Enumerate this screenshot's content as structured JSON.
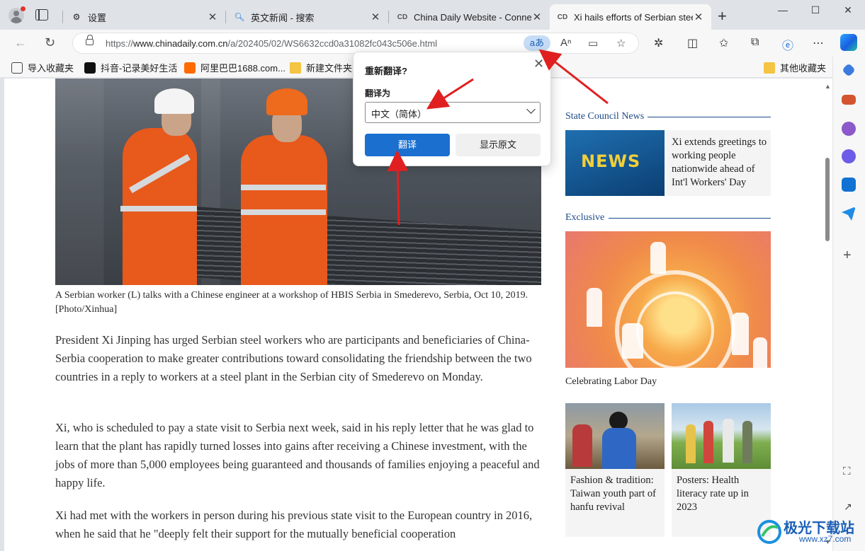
{
  "tabs": [
    {
      "title": "设置",
      "icon": "gear-icon"
    },
    {
      "title": "英文新闻 - 搜索",
      "icon": "search-icon"
    },
    {
      "title": "China Daily Website - Connecti",
      "icon": "cd-logo-icon"
    },
    {
      "title": "Xi hails efforts of Serbian steel",
      "icon": "cd-logo-icon",
      "active": true
    }
  ],
  "address_bar": {
    "url_prefix": "https://",
    "url_host": "www.chinadaily.com.cn",
    "url_path": "/a/202405/02/WS6632ccd0a31082fc043c506e.html",
    "translate_badge": "aあ"
  },
  "favorites": [
    {
      "label": "导入收藏夹",
      "icon": "import-icon"
    },
    {
      "label": "抖音-记录美好生活",
      "icon": "douyin-icon"
    },
    {
      "label": "阿里巴巴1688.com...",
      "icon": "alibaba-icon"
    },
    {
      "label": "新建文件夹",
      "icon": "folder-icon"
    },
    {
      "label": "其他收藏夹",
      "icon": "folder-icon"
    }
  ],
  "translate_popup": {
    "title": "重新翻译?",
    "label": "翻译为",
    "selected_language": "中文（简体）",
    "translate_button": "翻译",
    "show_original_button": "显示原文"
  },
  "article": {
    "caption": "A Serbian worker (L) talks with a Chinese engineer at a workshop of HBIS Serbia in Smederevo, Serbia, Oct 10, 2019. [Photo/Xinhua]",
    "paragraphs": [
      "President Xi Jinping has urged Serbian steel workers who are participants and beneficiaries of China-Serbia cooperation to make greater contributions toward consolidating the friendship between the two countries in a reply to workers at a steel plant in the Serbian city of Smederevo on Monday.",
      "Xi, who is scheduled to pay a state visit to Serbia next week, said in his reply letter that he was glad to learn that the plant has rapidly turned losses into gains after receiving a Chinese investment, with the jobs of more than 5,000 employees being guaranteed and thousands of families enjoying a peaceful and happy life.",
      "Xi had met with the workers in person during his previous state visit to the European country in 2016, when he said that he \"deeply felt their support for the mutually beneficial cooperation"
    ]
  },
  "sidebar_right": {
    "state_council": {
      "section": "State Council News",
      "image_word": "NEWS",
      "headline": "Xi extends greetings to working people nationwide ahead of Int'l Workers' Day"
    },
    "exclusive": {
      "section": "Exclusive",
      "headline": "Celebrating Labor Day"
    },
    "cards": [
      {
        "headline": "Fashion & tradition: Taiwan youth part of hanfu revival"
      },
      {
        "headline": "Posters: Health literacy rate up in 2023"
      }
    ]
  },
  "watermark": {
    "name": "极光下载站",
    "url": "www.xz7.com"
  },
  "colors": {
    "accent": "#1a6fcf",
    "arrow": "#e02020",
    "section": "#1b4a8a"
  }
}
